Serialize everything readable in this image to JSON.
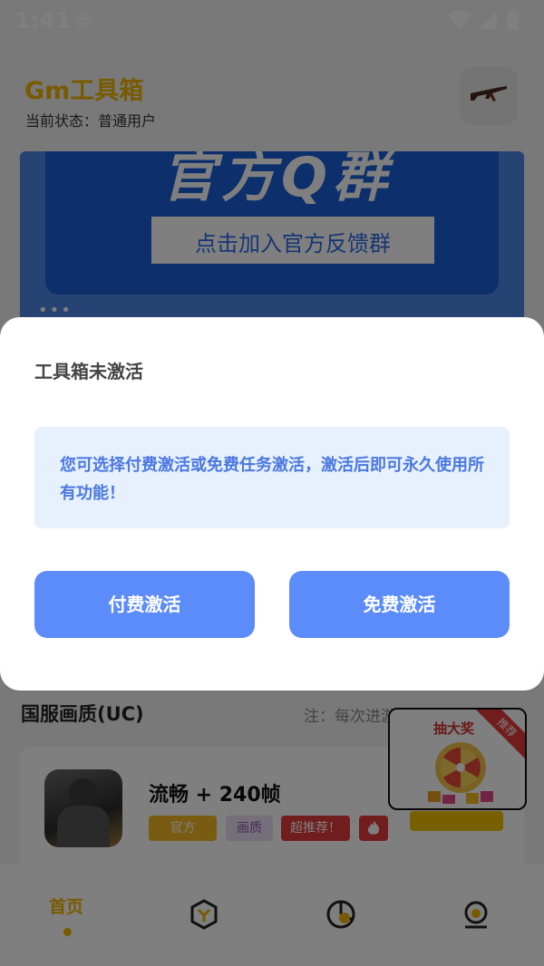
{
  "status_bar": {
    "time": "1:41"
  },
  "app": {
    "title": "Gm工具箱",
    "status_label": "当前状态：",
    "status_value": "普通用户"
  },
  "banner": {
    "title": "官方Q群",
    "button_text": "点击加入官方反馈群",
    "page_dots": "•••"
  },
  "section": {
    "title": "国服画质(UC)",
    "note": "注：每次进游戏都要生效一"
  },
  "game_card": {
    "name": "流畅 + 240帧",
    "tag_official": "官方",
    "tag_quality": "画质",
    "tag_recommend": "超推荐！"
  },
  "prize_float": {
    "title": "抽大奖",
    "ribbon": "推荐"
  },
  "bottom_nav": {
    "home_label": "首页"
  },
  "dialog": {
    "title": "工具箱未激活",
    "message": "您可选择付费激活或免费任务激活，激活后即可永久使用所有功能！",
    "pay_button": "付费激活",
    "free_button": "免费激活"
  },
  "colors": {
    "accent": "#f0b400",
    "primary_button": "#5b8cfa",
    "message_bg": "#e6f1fd",
    "message_text": "#4c78e0"
  }
}
